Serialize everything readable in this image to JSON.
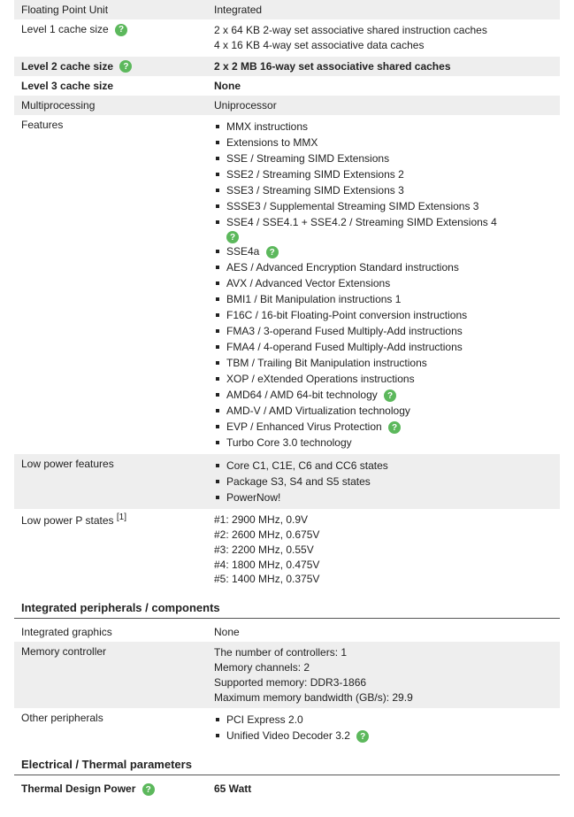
{
  "rows": {
    "fpu": {
      "label": "Floating Point Unit",
      "value": "Integrated"
    },
    "l1": {
      "label": "Level 1 cache size",
      "value": "2 x 64 KB 2-way set associative shared instruction caches\n4 x 16 KB 4-way set associative data caches"
    },
    "l2": {
      "label": "Level 2 cache size",
      "value": "2 x 2 MB 16-way set associative shared caches"
    },
    "l3": {
      "label": "Level 3 cache size",
      "value": "None"
    },
    "mp": {
      "label": "Multiprocessing",
      "value": "Uniprocessor"
    },
    "features": {
      "label": "Features"
    },
    "lowpower": {
      "label": "Low power features"
    },
    "pstates": {
      "label": "Low power P states",
      "value": "#1: 2900 MHz, 0.9V\n#2: 2600 MHz, 0.675V\n#3: 2200 MHz, 0.55V\n#4: 1800 MHz, 0.475V\n#5: 1400 MHz, 0.375V",
      "ref": "[1]"
    },
    "igfx": {
      "label": "Integrated graphics",
      "value": "None"
    },
    "memctrl": {
      "label": "Memory controller",
      "value": "The number of controllers: 1\nMemory channels: 2\nSupported memory: DDR3-1866\nMaximum memory bandwidth (GB/s): 29.9"
    },
    "otherperiph": {
      "label": "Other peripherals"
    },
    "tdp": {
      "label": "Thermal Design Power",
      "value": "65 Watt"
    }
  },
  "features_list": [
    {
      "text": "MMX instructions"
    },
    {
      "text": "Extensions to MMX"
    },
    {
      "text": "SSE / Streaming SIMD Extensions"
    },
    {
      "text": "SSE2 / Streaming SIMD Extensions 2"
    },
    {
      "text": "SSE3 / Streaming SIMD Extensions 3"
    },
    {
      "text": "SSSE3 / Supplemental Streaming SIMD Extensions 3"
    },
    {
      "text": "SSE4 / SSE4.1 + SSE4.2 / Streaming SIMD Extensions 4",
      "help_below": true
    },
    {
      "text": "SSE4a",
      "help": true
    },
    {
      "text": "AES / Advanced Encryption Standard instructions"
    },
    {
      "text": "AVX / Advanced Vector Extensions"
    },
    {
      "text": "BMI1 / Bit Manipulation instructions 1"
    },
    {
      "text": "F16C / 16-bit Floating-Point conversion instructions"
    },
    {
      "text": "FMA3 / 3-operand Fused Multiply-Add instructions"
    },
    {
      "text": "FMA4 / 4-operand Fused Multiply-Add instructions"
    },
    {
      "text": "TBM / Trailing Bit Manipulation instructions"
    },
    {
      "text": "XOP / eXtended Operations instructions"
    },
    {
      "text": "AMD64 / AMD 64-bit technology",
      "help": true
    },
    {
      "text": "AMD-V / AMD Virtualization technology"
    },
    {
      "text": "EVP / Enhanced Virus Protection",
      "help": true
    },
    {
      "text": "Turbo Core 3.0 technology"
    }
  ],
  "lowpower_list": [
    {
      "text": "Core C1, C1E, C6 and CC6 states"
    },
    {
      "text": "Package S3, S4 and S5 states"
    },
    {
      "text": "PowerNow!"
    }
  ],
  "otherperiph_list": [
    {
      "text": "PCI Express 2.0"
    },
    {
      "text": "Unified Video Decoder 3.2",
      "help": true
    }
  ],
  "sections": {
    "periph": "Integrated peripherals / components",
    "thermal": "Electrical / Thermal parameters"
  },
  "help_glyph": "?"
}
